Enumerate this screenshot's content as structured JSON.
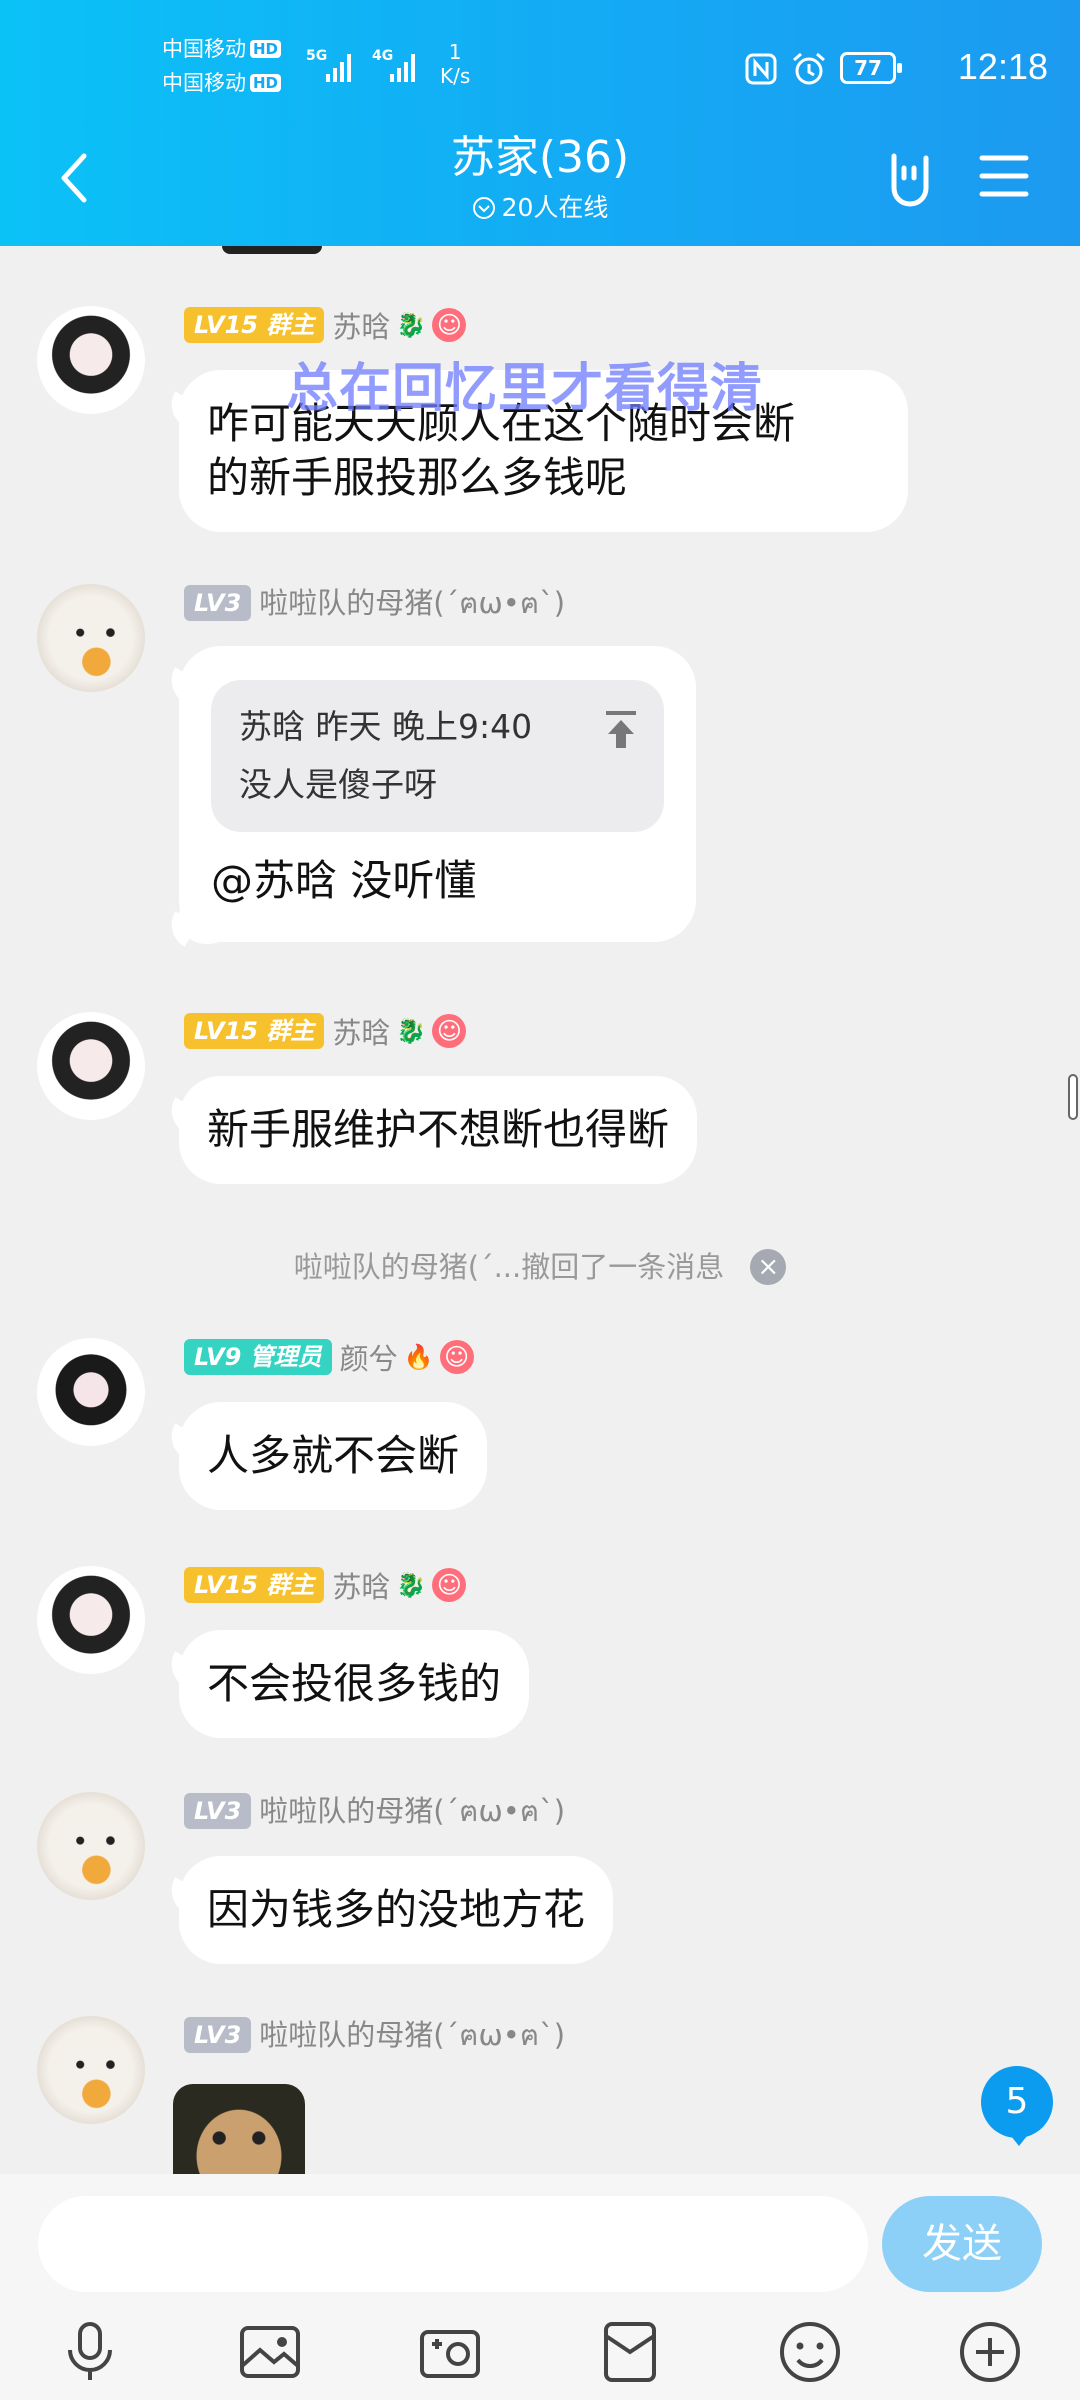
{
  "status_bar": {
    "carrier1": "中国移动",
    "carrier2": "中国移动",
    "hd": "HD",
    "sig1": "5G",
    "sig2": "4G",
    "speed_value": "1",
    "speed_unit": "K/s",
    "battery": "77",
    "time": "12:18"
  },
  "header": {
    "title": "苏家(36)",
    "online": "20人在线"
  },
  "watermark": "总在回忆里才看得清",
  "messages": [
    {
      "level": "LV15",
      "role": "群主",
      "name": "苏晗",
      "text_line1": "咋可能天天顾人在这个随时会断",
      "text_line2": "的新手服投那么多钱呢"
    },
    {
      "level": "LV3",
      "name": "啦啦队的母猪(´ฅω•ฅ`)",
      "quote_author": "苏晗 昨天 晚上9:40",
      "quote_text": "没人是傻子呀",
      "text": "@苏晗 没听懂"
    },
    {
      "level": "LV15",
      "role": "群主",
      "name": "苏晗",
      "text": "新手服维护不想断也得断"
    },
    {
      "system": "啦啦队的母猪(´...撤回了一条消息"
    },
    {
      "level": "LV9",
      "role": "管理员",
      "name": "颜兮",
      "text": "人多就不会断"
    },
    {
      "level": "LV15",
      "role": "群主",
      "name": "苏晗",
      "text": "不会投很多钱的"
    },
    {
      "level": "LV3",
      "name": "啦啦队的母猪(´ฅω•ฅ`)",
      "text": "因为钱多的没地方花"
    },
    {
      "level": "LV3",
      "name": "啦啦队的母猪(´ฅω•ฅ`)"
    }
  ],
  "unread_count": "5",
  "input": {
    "send_label": "发送",
    "value": ""
  },
  "toolbar_icons": [
    "microphone-icon",
    "image-icon",
    "camera-icon",
    "red-packet-icon",
    "emoji-icon",
    "plus-icon"
  ],
  "colors": {
    "header_gradient_start": "#0bc2f7",
    "header_gradient_end": "#1c9af0",
    "send_button": "#8dd0f7",
    "owner_badge": "#f7c12e",
    "admin_badge": "#35d4c2",
    "member_badge": "#b7bcc8"
  }
}
